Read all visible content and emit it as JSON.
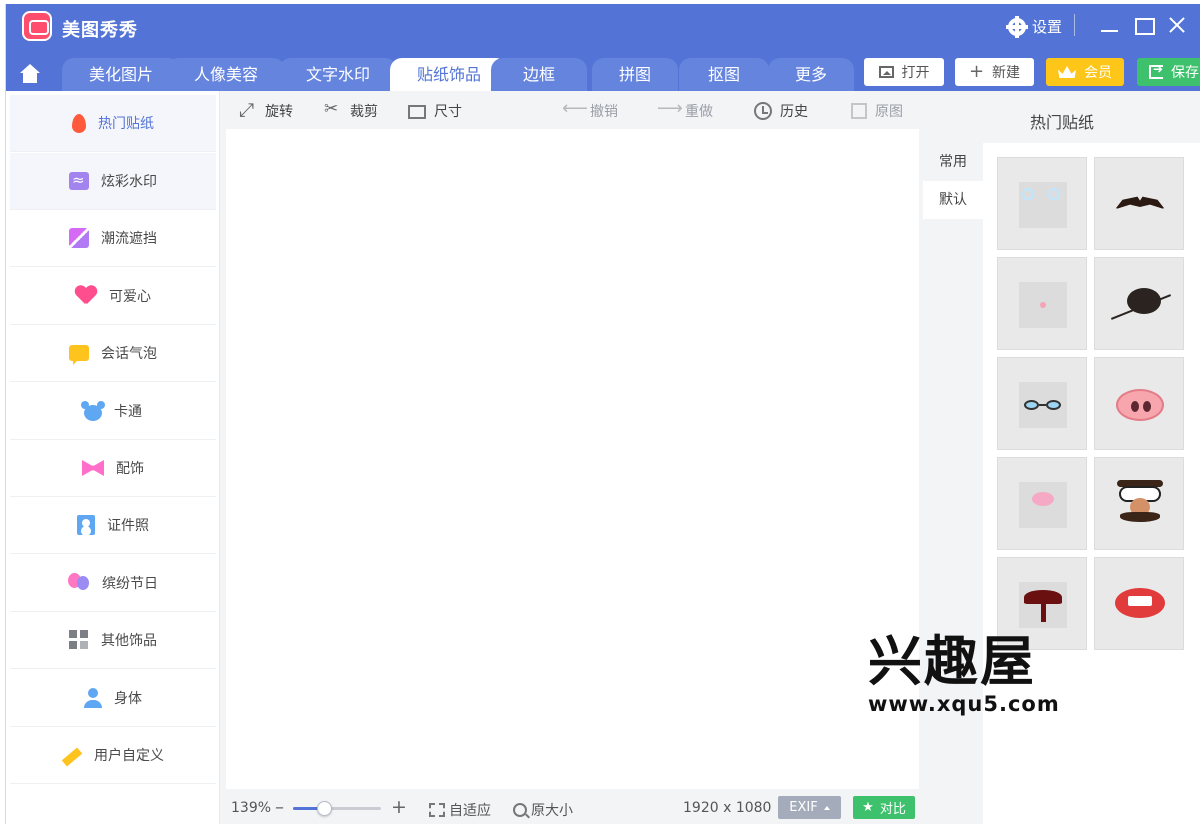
{
  "app": {
    "title": "美图秀秀",
    "settings_label": "设置"
  },
  "tabs": [
    {
      "label": "美化图片",
      "active": false
    },
    {
      "label": "人像美容",
      "active": false
    },
    {
      "label": "文字水印",
      "active": false
    },
    {
      "label": "贴纸饰品",
      "active": true
    },
    {
      "label": "边框",
      "active": false
    },
    {
      "label": "拼图",
      "active": false
    },
    {
      "label": "抠图",
      "active": false
    },
    {
      "label": "更多",
      "active": false
    }
  ],
  "actions": {
    "open": "打开",
    "new": "新建",
    "vip": "会员",
    "save": "保存"
  },
  "sidebar": {
    "items": [
      {
        "label": "热门贴纸",
        "icon": "flame-icon"
      },
      {
        "label": "炫彩水印",
        "icon": "wave-icon"
      },
      {
        "label": "潮流遮挡",
        "icon": "stripe-icon"
      },
      {
        "label": "可爱心",
        "icon": "heart-icon"
      },
      {
        "label": "会话气泡",
        "icon": "speech-bubble-icon"
      },
      {
        "label": "卡通",
        "icon": "bear-icon"
      },
      {
        "label": "配饰",
        "icon": "bow-icon"
      },
      {
        "label": "证件照",
        "icon": "id-photo-icon"
      },
      {
        "label": "缤纷节日",
        "icon": "balloon-icon"
      },
      {
        "label": "其他饰品",
        "icon": "grid-icon"
      },
      {
        "label": "身体",
        "icon": "person-icon"
      },
      {
        "label": "用户自定义",
        "icon": "pencil-icon"
      }
    ]
  },
  "toolbar": {
    "rotate": "旋转",
    "crop": "裁剪",
    "size": "尺寸",
    "undo": "撤销",
    "redo": "重做",
    "history": "历史",
    "original": "原图"
  },
  "status": {
    "zoom": "139%",
    "zoom_fraction": 0.35,
    "fit": "自适应",
    "actual_size": "原大小",
    "resolution": "1920 x 1080",
    "exif": "EXIF",
    "compare": "对比"
  },
  "right_panel": {
    "title": "热门贴纸",
    "tabs": [
      {
        "label": "常用",
        "selected": false
      },
      {
        "label": "默认",
        "selected": true
      }
    ]
  },
  "watermark": {
    "text": "兴趣屋",
    "url": "www.xqu5.com"
  }
}
